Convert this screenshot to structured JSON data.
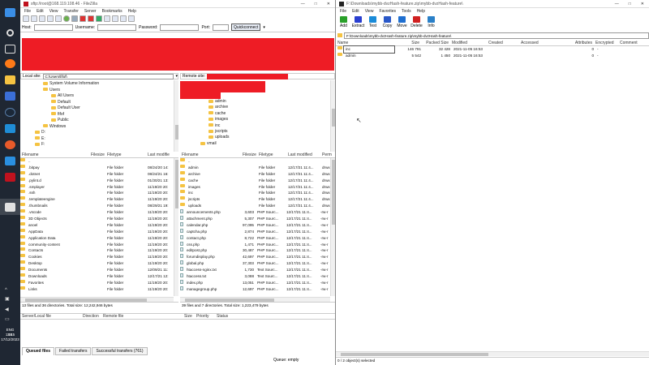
{
  "taskbar": {
    "clock_time": "13:15",
    "clock_date": "17/12/2023",
    "lang": "ENG",
    "lang2": "SK"
  },
  "filezilla": {
    "title": "sftp://root@168.119.108.46 - FileZilla",
    "menu": [
      "File",
      "Edit",
      "View",
      "Transfer",
      "Server",
      "Bookmarks",
      "Help"
    ],
    "quickconnect": {
      "host_label": "Host:",
      "user_label": "Username:",
      "pass_label": "Password:",
      "port_label": "Port:",
      "button": "Quickconnect"
    },
    "local_site_label": "Local site:",
    "local_site_path": "C:\\Users\\fifof\\",
    "remote_site_label": "Remote site:",
    "local_tree": [
      "System Volume Information",
      "Users",
      "All Users",
      "Default",
      "Default User",
      "fifof",
      "Public",
      "Windows",
      "D:",
      "E:",
      "F:"
    ],
    "remote_tree": [
      "admin",
      "archive",
      "cache",
      "images",
      "inc",
      "jscripts",
      "uploads",
      "vmail"
    ],
    "local_headers": [
      "Filename",
      "Filesize",
      "Filetype",
      "Last modifie"
    ],
    "local_rows": [
      [
        "..",
        "",
        "",
        ""
      ],
      [
        ".bitpay",
        "",
        "File folder",
        "08/24/20 14:"
      ],
      [
        ".dotnet",
        "",
        "File folder",
        "08/24/21 16:"
      ],
      [
        ".pylint.d",
        "",
        "File folder",
        "01/30/21 13:"
      ],
      [
        ".smplayer",
        "",
        "File folder",
        "11/19/20 20:"
      ],
      [
        ".ssh",
        "",
        "File folder",
        "11/19/20 20:"
      ],
      [
        ".templateengine",
        "",
        "File folder",
        "11/19/20 20:"
      ],
      [
        ".thumbnails",
        "",
        "File folder",
        "08/29/21 19:"
      ],
      [
        ".vscode",
        "",
        "File folder",
        "11/19/20 20:"
      ],
      [
        "3D Objects",
        "",
        "File folder",
        "11/19/20 20:"
      ],
      [
        "anoel",
        "",
        "File folder",
        "11/19/20 20:"
      ],
      [
        "AppData",
        "",
        "File folder",
        "11/19/20 20:"
      ],
      [
        "Application Data",
        "",
        "File folder",
        "11/19/20 20:"
      ],
      [
        "community-content",
        "",
        "File folder",
        "11/19/20 20:"
      ],
      [
        "Contacts",
        "",
        "File folder",
        "11/19/20 20:"
      ],
      [
        "Cookies",
        "",
        "File folder",
        "11/19/20 20:"
      ],
      [
        "Desktop",
        "",
        "File folder",
        "11/19/20 20:"
      ],
      [
        "Documents",
        "",
        "File folder",
        "12/09/21 11:"
      ],
      [
        "Downloads",
        "",
        "File folder",
        "12/17/21 12:"
      ],
      [
        "Favorites",
        "",
        "File folder",
        "11/19/20 20:"
      ],
      [
        "Links",
        "",
        "File folder",
        "11/19/20 20:"
      ]
    ],
    "remote_headers": [
      "Filename",
      "Filesize",
      "Filetype",
      "Last modified",
      "Perm"
    ],
    "remote_rows": [
      [
        "..",
        "",
        "",
        "",
        ""
      ],
      [
        "admin",
        "",
        "File folder",
        "12/17/21 11:4...",
        "drwx"
      ],
      [
        "archive",
        "",
        "File folder",
        "12/17/21 11:4...",
        "drwx"
      ],
      [
        "cache",
        "",
        "File folder",
        "12/17/21 11:4...",
        "drwx"
      ],
      [
        "images",
        "",
        "File folder",
        "12/17/21 11:4...",
        "drwx"
      ],
      [
        "inc",
        "",
        "File folder",
        "12/17/21 11:4...",
        "drwx"
      ],
      [
        "jscripts",
        "",
        "File folder",
        "12/17/21 11:4...",
        "drwx"
      ],
      [
        "uploads",
        "",
        "File folder",
        "12/17/21 11:4...",
        "drwx"
      ],
      [
        "announcements.php",
        "3,603",
        "PHP Sourc...",
        "12/17/21 11:4...",
        "-rw-r"
      ],
      [
        "attachment.php",
        "5,307",
        "PHP Sourc...",
        "12/17/21 11:4...",
        "-rw-r"
      ],
      [
        "calendar.php",
        "97,095",
        "PHP Sourc...",
        "12/17/21 11:4...",
        "-rw-r"
      ],
      [
        "captcha.php",
        "2,874",
        "PHP Sourc...",
        "12/17/21 11:4...",
        "-rw-r"
      ],
      [
        "contact.php",
        "8,722",
        "PHP Sourc...",
        "12/17/21 11:4...",
        "-rw-r"
      ],
      [
        "css.php",
        "1,471",
        "PHP Sourc...",
        "12/17/21 11:4...",
        "-rw-r"
      ],
      [
        "editpost.php",
        "30,487",
        "PHP Sourc...",
        "12/17/21 11:4...",
        "-rw-r"
      ],
      [
        "forumdisplay.php",
        "42,697",
        "PHP Sourc...",
        "12/17/21 11:4...",
        "-rw-r"
      ],
      [
        "global.php",
        "37,303",
        "PHP Sourc...",
        "12/17/21 11:4...",
        "-rw-r"
      ],
      [
        "htaccess-nginx.txt",
        "1,730",
        "Text Sourc...",
        "12/17/21 11:4...",
        "-rw-r"
      ],
      [
        "htaccess.txt",
        "3,088",
        "Text Sourc...",
        "12/17/21 11:4...",
        "-rw-r"
      ],
      [
        "index.php",
        "13,051",
        "PHP Sourc...",
        "12/17/21 11:4...",
        "-rw-r"
      ],
      [
        "managegroup.php",
        "12,697",
        "PHP Sourc...",
        "12/17/21 11:4...",
        "-rw-r"
      ]
    ],
    "local_status": "13 files and 36 directories. Total size: 12,242,946 bytes",
    "remote_status": "39 files and 7 directories. Total size: 1,223,479 bytes",
    "queue_headers": [
      "Server/Local file",
      "Direction",
      "Remote file",
      "Size",
      "Priority",
      "Status"
    ],
    "tabs": [
      "Queued files",
      "Failed transfers",
      "Successful transfers (761)"
    ],
    "queue_status": "Queue: empty"
  },
  "sevenzip": {
    "title": "F:\\Downloads\\mybb-dvzHash-feature.zip\\mybb-dvzHash-feature\\",
    "menu": [
      "File",
      "Edit",
      "View",
      "Favorites",
      "Tools",
      "Help"
    ],
    "tools": [
      {
        "label": "Add",
        "color": "#2aa02a"
      },
      {
        "label": "Extract",
        "color": "#2a3fd0"
      },
      {
        "label": "Test",
        "color": "#1a8bd8"
      },
      {
        "label": "Copy",
        "color": "#2a58c8"
      },
      {
        "label": "Move",
        "color": "#1f6fd0"
      },
      {
        "label": "Delete",
        "color": "#d02020"
      },
      {
        "label": "Info",
        "color": "#2a80c8"
      }
    ],
    "address": "F:\\Downloads\\mybb-dvzHash-feature.zip\\mybb-dvzHash-feature\\",
    "headers": [
      "Name",
      "Size",
      "Packed Size",
      "Modified",
      "Created",
      "Accessed",
      "Attributes",
      "Encrypted",
      "Comment"
    ],
    "rows": [
      [
        "inc",
        "146 791",
        "32 428",
        "2021-11-05 16:53",
        "",
        "",
        "0",
        "-",
        ""
      ],
      [
        "admin",
        "5 542",
        "1 450",
        "2021-11-05 16:53",
        "",
        "",
        "0",
        "-",
        ""
      ]
    ],
    "status": "0 / 2 object(s) selected"
  },
  "colors": {
    "taskbar": "#1f2733",
    "redaction": "#ee1c25",
    "folder": "#f5c342"
  }
}
